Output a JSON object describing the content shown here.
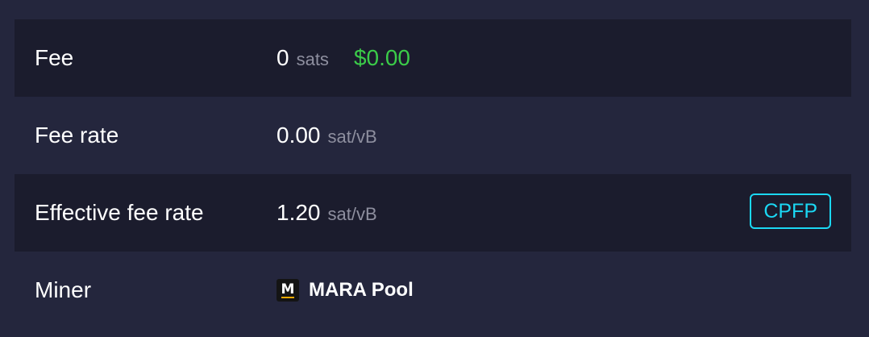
{
  "rows": {
    "fee": {
      "label": "Fee",
      "amount": "0",
      "unit": "sats",
      "fiat": "$0.00"
    },
    "fee_rate": {
      "label": "Fee rate",
      "amount": "0.00",
      "unit": "sat/vB"
    },
    "effective_fee_rate": {
      "label": "Effective fee rate",
      "amount": "1.20",
      "unit": "sat/vB",
      "badge": "CPFP"
    },
    "miner": {
      "label": "Miner",
      "logo_letter": "M",
      "pool_name": "MARA Pool"
    }
  },
  "colors": {
    "page_bg": "#24263d",
    "row_dark_bg": "#1b1c2d",
    "fiat_green": "#3bcc49",
    "badge_cyan": "#1bd8f4",
    "unit_grey": "#8e8f9f",
    "logo_accent": "#f2a900"
  },
  "icons": {
    "pool_logo": "mara-pool-logo-icon"
  }
}
